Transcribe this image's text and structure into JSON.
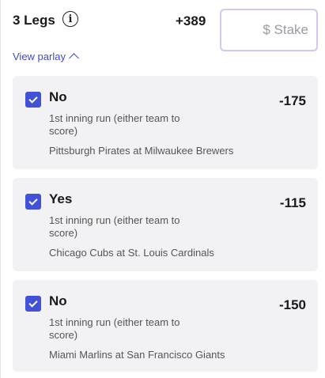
{
  "header": {
    "legs_title": "3 Legs",
    "info_icon": "info-icon",
    "parlay_odds": "+389",
    "stake_placeholder": "$ Stake",
    "view_parlay_label": "View parlay",
    "view_parlay_icon": "chevron-up-icon"
  },
  "legs": [
    {
      "checked": true,
      "selection": "No",
      "odds": "-175",
      "market": "1st inning run (either team to score)",
      "matchup": "Pittsburgh Pirates at Milwaukee Brewers"
    },
    {
      "checked": true,
      "selection": "Yes",
      "odds": "-115",
      "market": "1st inning run (either team to score)",
      "matchup": "Chicago Cubs at St. Louis Cardinals"
    },
    {
      "checked": true,
      "selection": "No",
      "odds": "-150",
      "market": "1st inning run (either team to score)",
      "matchup": "Miami Marlins at San Francisco Giants"
    }
  ],
  "colors": {
    "accent": "#4252d6",
    "link": "#3c4bd1",
    "card_bg": "#f2f2f4",
    "stake_border": "#c9cbf3"
  }
}
